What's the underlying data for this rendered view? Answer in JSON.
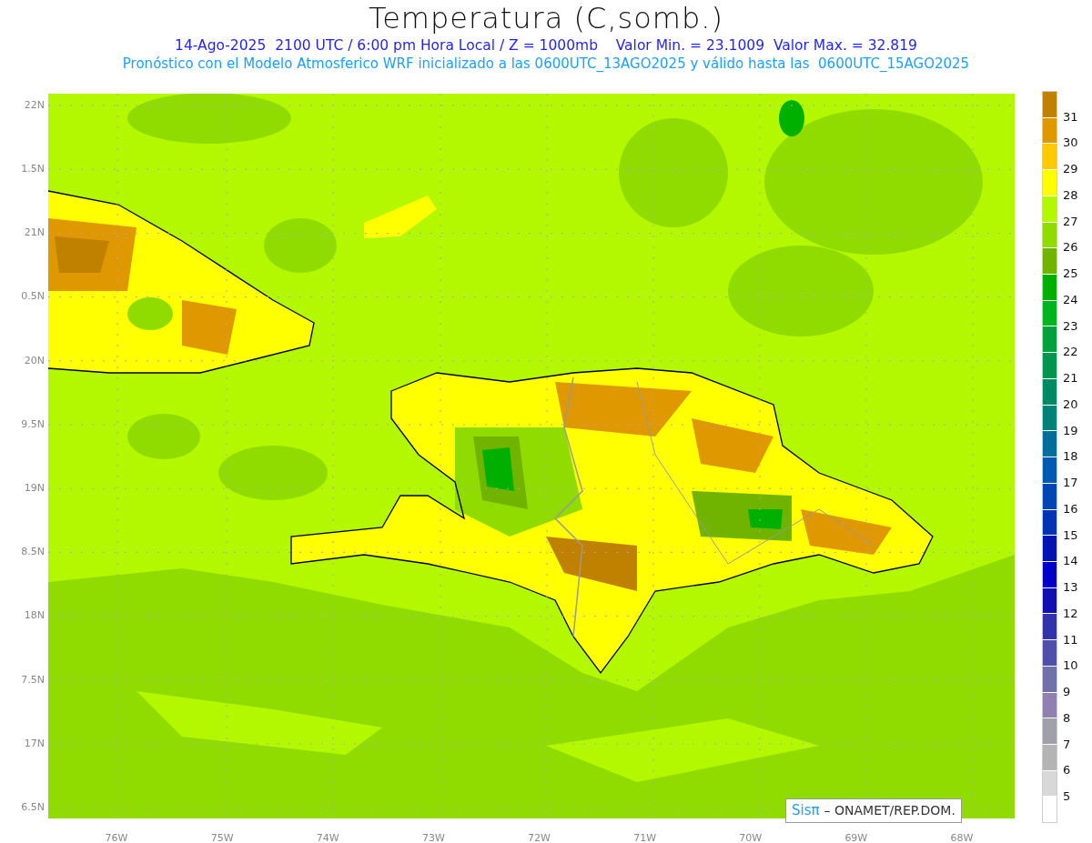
{
  "title": "Temperatura (C,somb.)",
  "info_line": "14-Ago-2025  2100 UTC / 6:00 pm Hora Local / Z = 1000mb    Valor Min. = 23.1009  Valor Max. = 32.819",
  "forecast_line": "Pronóstico con el Modelo Atmosferico WRF inicializado a las 0600UTC_13AGO2025 y válido hasta las  0600UTC_15AGO2025",
  "lat_labels": [
    "22N",
    "1.5N",
    "21N",
    "0.5N",
    "20N",
    "9.5N",
    "19N",
    "8.5N",
    "18N",
    "7.5N",
    "17N",
    "6.5N"
  ],
  "lon_labels": [
    "76W",
    "75W",
    "74W",
    "73W",
    "72W",
    "71W",
    "70W",
    "69W",
    "68W"
  ],
  "colorbar": {
    "bins": [
      {
        "color": "#c08000"
      },
      {
        "color": "#e09800"
      },
      {
        "color": "#ffc800"
      },
      {
        "color": "#ffff00"
      },
      {
        "color": "#b4f800"
      },
      {
        "color": "#90dc00"
      },
      {
        "color": "#70b400"
      },
      {
        "color": "#00b000"
      },
      {
        "color": "#00b41e"
      },
      {
        "color": "#00a03c"
      },
      {
        "color": "#009650"
      },
      {
        "color": "#008a64"
      },
      {
        "color": "#008278"
      },
      {
        "color": "#006e9a"
      },
      {
        "color": "#005ab4"
      },
      {
        "color": "#0046b4"
      },
      {
        "color": "#0032b4"
      },
      {
        "color": "#0014b4"
      },
      {
        "color": "#0000c8"
      },
      {
        "color": "#1010b0"
      },
      {
        "color": "#3232aa"
      },
      {
        "color": "#5050aa"
      },
      {
        "color": "#7070aa"
      },
      {
        "color": "#9080b0"
      },
      {
        "color": "#a0a0a8"
      },
      {
        "color": "#b4b4b4"
      },
      {
        "color": "#d8d8d8"
      },
      {
        "color": "#ffffff"
      }
    ],
    "labels": [
      "31",
      "30",
      "29",
      "28",
      "27",
      "26",
      "25",
      "24",
      "23",
      "22",
      "21",
      "20",
      "19",
      "18",
      "17",
      "16",
      "15",
      "14",
      "13",
      "12",
      "11",
      "10",
      "9",
      "8",
      "7",
      "6",
      "5"
    ]
  },
  "credit": {
    "logo": "Sisπ",
    "text": "– ONAMET/REP.DOM."
  }
}
